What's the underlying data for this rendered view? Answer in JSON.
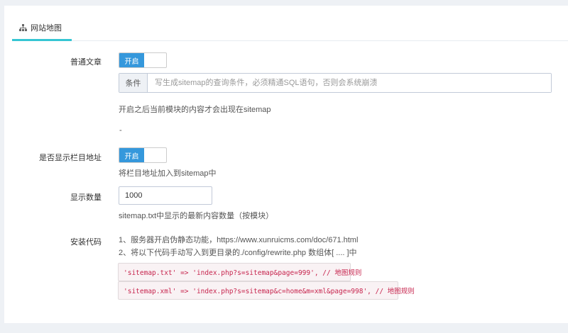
{
  "tab": {
    "label": "网站地图",
    "icon": "sitemap-icon"
  },
  "fields": {
    "article": {
      "label": "普通文章",
      "toggle_on": "开启",
      "condition_addon": "条件",
      "condition_placeholder": "写生成sitemap的查询条件，必须精通SQL语句，否则会系统崩溃",
      "help": "开启之后当前模块的内容才会出现在sitemap",
      "dash": "-"
    },
    "category": {
      "label": "是否显示栏目地址",
      "toggle_on": "开启",
      "help": "将栏目地址加入到sitemap中"
    },
    "count": {
      "label": "显示数量",
      "value": "1000",
      "help": "sitemap.txt中显示的最新内容数量（按模块）"
    },
    "install": {
      "label": "安装代码",
      "line1": "1、服务器开启伪静态功能，https://www.xunruicms.com/doc/671.html",
      "line2": "2、将以下代码手动写入到更目录的./config/rewrite.php 数组体[ .... ]中",
      "code1": "'sitemap.txt' => 'index.php?s=sitemap&page=999', // 地图规则",
      "code2": "'sitemap.xml' => 'index.php?s=sitemap&c=home&m=xml&page=998', // 地图规则"
    }
  },
  "colors": {
    "accent": "#36c6d3",
    "toggle_on": "#3598dc",
    "code": "#c7254e"
  }
}
